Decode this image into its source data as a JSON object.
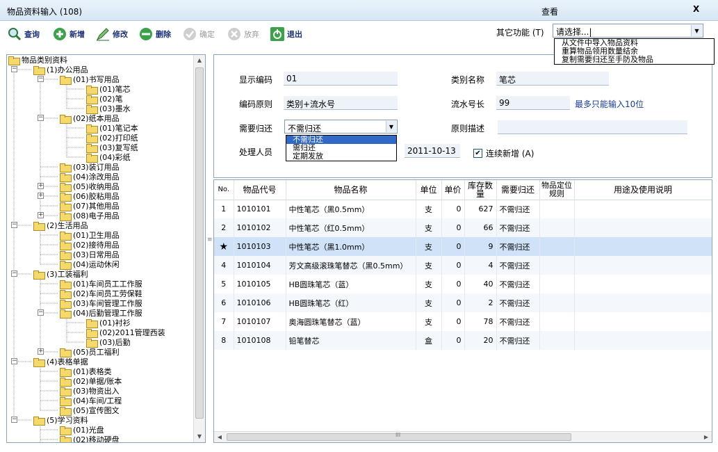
{
  "window": {
    "title": "物品资料输入 (108)",
    "mode": "查看",
    "close": "X"
  },
  "toolbar": {
    "query": "查询",
    "add": "新增",
    "edit": "修改",
    "delete": "删除",
    "confirm": "确定",
    "discard": "放弃",
    "exit": "退出"
  },
  "other": {
    "label": "其它功能 (T)",
    "value": "请选择...|",
    "options": [
      "从文件中导入物品资料",
      "重算物品领用数量结余",
      "复制需要归还至手防及物品"
    ]
  },
  "tree": {
    "root": "物品类别资料",
    "items": [
      "(1)办公用品",
      "(01)书写用品",
      "(01)笔芯",
      "(02)笔",
      "(03)墨水",
      "(02)纸本用品",
      "(01)笔记本",
      "(02)打印纸",
      "(03)复写纸",
      "(04)彩纸",
      "(03)装订用品",
      "(04)涂改用品",
      "(05)收纳用品",
      "(06)胶粘用品",
      "(07)其他用品",
      "(08)电子用品",
      "(2)生活用品",
      "(01)卫生用品",
      "(02)接待用品",
      "(03)日常用品",
      "(04)运动休闲",
      "(3)工装福利",
      "(01)车间员工工作服",
      "(02)车间员工劳保鞋",
      "(03)车间管理工作服",
      "(04)后勤管理工作服",
      "(01)衬衫",
      "(02)2011管理西装",
      "(03)后勤",
      "(05)员工福利",
      "(4)表格单据",
      "(01)表格类",
      "(02)单据/账本",
      "(03)物资出入",
      "(04)车间/工程",
      "(05)宣传图文",
      "(5)学习资料",
      "(01)光盘",
      "(02)移动硬盘"
    ]
  },
  "form": {
    "display_code_label": "显示编码",
    "display_code": "01",
    "category_name_label": "类别名称",
    "category_name": "笔芯",
    "code_rule_label": "编码原则",
    "code_rule": "类别+流水号",
    "serial_len_label": "流水号长",
    "serial_len": "99",
    "serial_note": "最多只能输入10位",
    "need_return_label": "需要归还",
    "need_return": "不需归还",
    "need_return_options": [
      "不需归还",
      "需归还",
      "定期发放"
    ],
    "rule_desc_label": "原则描述",
    "rule_desc": "",
    "handler_label": "处理人员",
    "date": "2011-10-13",
    "continuous_add": "连续新增 (A)"
  },
  "grid": {
    "headers": [
      "No.",
      "物品代号",
      "物品名称",
      "单位",
      "单价",
      "库存数量",
      "需要归还",
      "物品定位规则",
      "用途及使用说明"
    ],
    "rows": [
      {
        "no": "1",
        "code": "1010101",
        "name": "中性笔芯（黑0.5mm）",
        "unit": "支",
        "price": "0",
        "stock": "627",
        "ret": "不需归还"
      },
      {
        "no": "2",
        "code": "1010102",
        "name": "中性笔芯（红0.5mm）",
        "unit": "支",
        "price": "0",
        "stock": "66",
        "ret": "不需归还"
      },
      {
        "no": "★",
        "code": "1010103",
        "name": "中性笔芯（黑1.0mm）",
        "unit": "支",
        "price": "0",
        "stock": "9",
        "ret": "不需归还"
      },
      {
        "no": "4",
        "code": "1010104",
        "name": "芳文高级滚珠笔替芯（黑0.5mm）",
        "unit": "支",
        "price": "0",
        "stock": "4",
        "ret": "不需归还"
      },
      {
        "no": "5",
        "code": "1010105",
        "name": "HB圆珠笔芯（蓝）",
        "unit": "支",
        "price": "0",
        "stock": "40",
        "ret": "不需归还"
      },
      {
        "no": "6",
        "code": "1010106",
        "name": "HB圆珠笔芯（红）",
        "unit": "支",
        "price": "0",
        "stock": "2",
        "ret": "不需归还"
      },
      {
        "no": "7",
        "code": "1010107",
        "name": "奥海圆珠笔替芯（蓝）",
        "unit": "支",
        "price": "0",
        "stock": "78",
        "ret": "不需归还"
      },
      {
        "no": "8",
        "code": "1010108",
        "name": "铅笔替芯",
        "unit": "盒",
        "price": "0",
        "stock": "20",
        "ret": "不需归还"
      }
    ],
    "scroll_grip": "III"
  },
  "colors": {
    "accent": "#3069c6",
    "selected_row": "#cfe2f7",
    "note": "#1b3a9e"
  }
}
